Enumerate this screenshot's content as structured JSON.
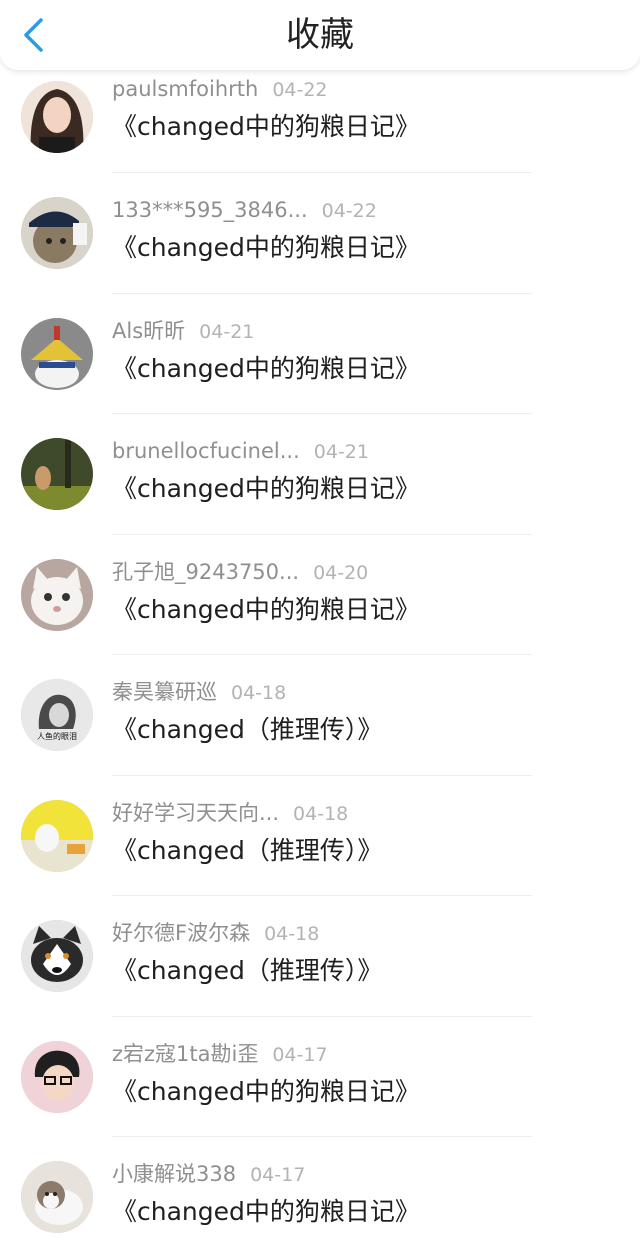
{
  "header": {
    "title": "收藏",
    "back_icon": "chevron-left-icon",
    "accent_color": "#2a9be8"
  },
  "items": [
    {
      "user": "paulsmfoihrth",
      "date": "04-22",
      "book": "《changed中的狗粮日记》",
      "avatar": "portrait-woman"
    },
    {
      "user": "133***595_3846...",
      "date": "04-22",
      "book": "《changed中的狗粮日记》",
      "avatar": "fbi-cat"
    },
    {
      "user": "Als昕昕",
      "date": "04-21",
      "book": "《changed中的狗粮日记》",
      "avatar": "cartoon-hat"
    },
    {
      "user": "brunellocfucinel...",
      "date": "04-21",
      "book": "《changed中的狗粮日记》",
      "avatar": "forest-child"
    },
    {
      "user": "孔子旭_9243750...",
      "date": "04-20",
      "book": "《changed中的狗粮日记》",
      "avatar": "white-cat"
    },
    {
      "user": "秦昊纂研巡",
      "date": "04-18",
      "book": "《changed（推理传）》",
      "avatar": "sketch-portrait"
    },
    {
      "user": "好好学习天天向...",
      "date": "04-18",
      "book": "《changed（推理传）》",
      "avatar": "yellow-illustration"
    },
    {
      "user": "好尔德F波尔森",
      "date": "04-18",
      "book": "《changed（推理传）》",
      "avatar": "husky-dog"
    },
    {
      "user": "z宕z寇1ta勘i歪",
      "date": "04-17",
      "book": "《changed中的狗粮日记》",
      "avatar": "boy-glasses"
    },
    {
      "user": "小康解说338",
      "date": "04-17",
      "book": "《changed中的狗粮日记》",
      "avatar": "husky-puppy"
    }
  ],
  "avatar_image_text": "人鱼的眼泪"
}
